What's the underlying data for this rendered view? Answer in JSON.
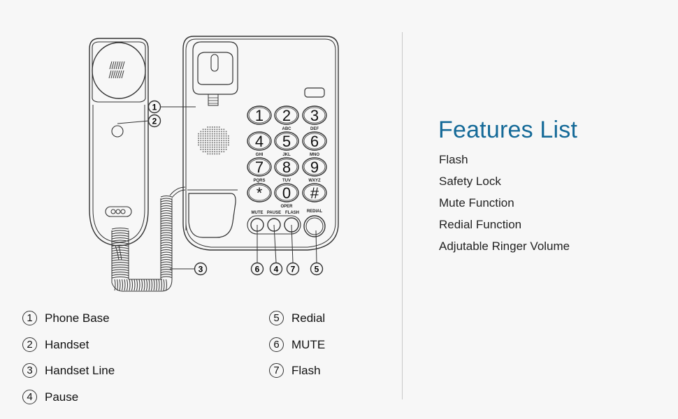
{
  "features": {
    "title": "Features List",
    "title_color": "#156a98",
    "items": [
      "Flash",
      "Safety Lock",
      "Mute Function",
      "Redial Function",
      "Adjutable Ringer Volume"
    ]
  },
  "legend": {
    "left": [
      {
        "num": "1",
        "label": "Phone Base"
      },
      {
        "num": "2",
        "label": "Handset"
      },
      {
        "num": "3",
        "label": "Handset Line"
      },
      {
        "num": "4",
        "label": "Pause"
      }
    ],
    "right": [
      {
        "num": "5",
        "label": "Redial"
      },
      {
        "num": "6",
        "label": "MUTE"
      },
      {
        "num": "7",
        "label": "Flash"
      }
    ]
  },
  "keypad": {
    "keys": [
      {
        "digit": "1",
        "letters": ""
      },
      {
        "digit": "2",
        "letters": "ABC"
      },
      {
        "digit": "3",
        "letters": "DEF"
      },
      {
        "digit": "4",
        "letters": "GHI"
      },
      {
        "digit": "5",
        "letters": "JKL"
      },
      {
        "digit": "6",
        "letters": "MNO"
      },
      {
        "digit": "7",
        "letters": "PQRS"
      },
      {
        "digit": "8",
        "letters": "TUV"
      },
      {
        "digit": "9",
        "letters": "WXYZ"
      },
      {
        "digit": "*",
        "letters": ""
      },
      {
        "digit": "0",
        "letters": "OPER"
      },
      {
        "digit": "#",
        "letters": ""
      }
    ],
    "function_labels": {
      "mute": "MUTE",
      "pause": "PAUSE",
      "flash": "FLASH",
      "redial": "REDIAL"
    }
  },
  "callouts": {
    "phone_base": "1",
    "handset": "2",
    "handset_line": "3",
    "mute": "6",
    "pause": "4",
    "flash": "7",
    "redial": "5"
  }
}
